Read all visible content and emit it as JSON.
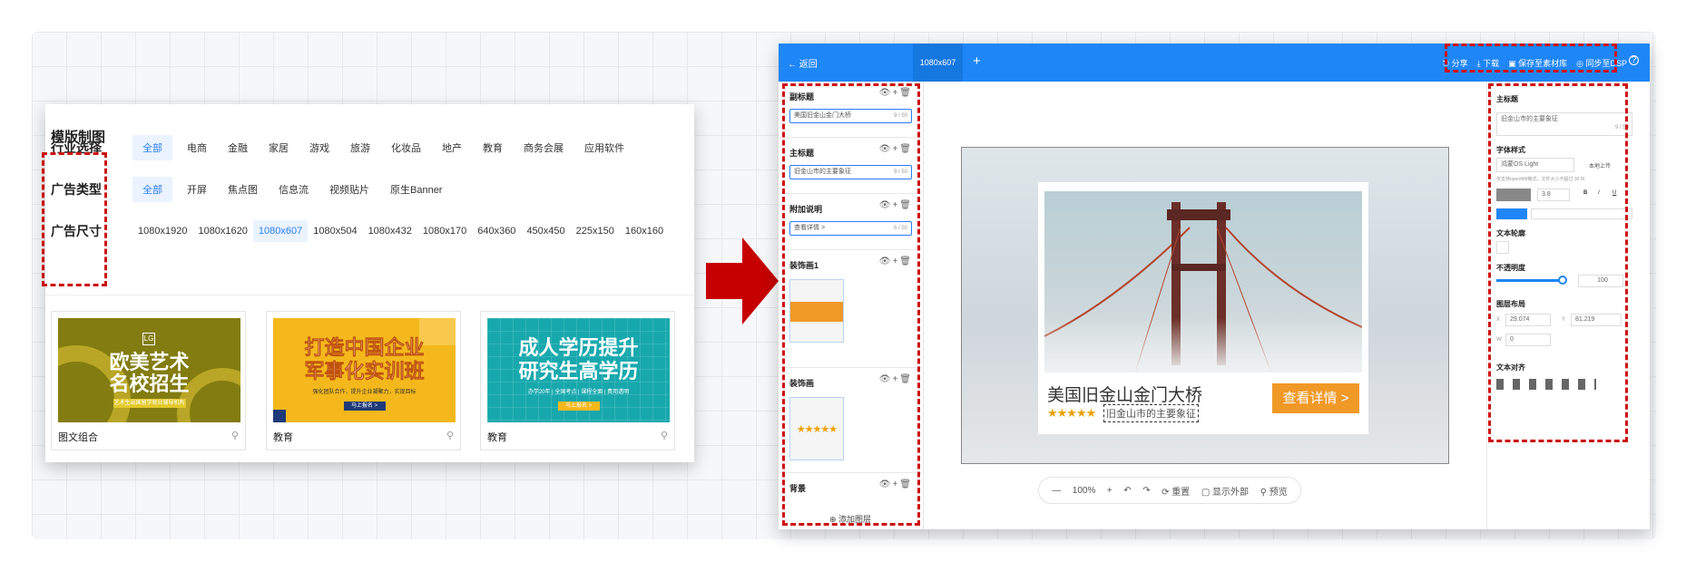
{
  "left_panel": {
    "title": "模版制图",
    "industry": {
      "label": "行业选择",
      "options": [
        "全部",
        "电商",
        "金融",
        "家居",
        "游戏",
        "旅游",
        "化妆品",
        "地产",
        "教育",
        "商务会展",
        "应用软件"
      ]
    },
    "ad_type": {
      "label": "广告类型",
      "options": [
        "全部",
        "开屏",
        "焦点图",
        "信息流",
        "视频贴片",
        "原生Banner"
      ]
    },
    "ad_size": {
      "label": "广告尺寸",
      "options": [
        "1080x1920",
        "1080x1620",
        "1080x607",
        "1080x504",
        "1080x432",
        "1080x170",
        "640x360",
        "450x450",
        "225x150",
        "160x160"
      ]
    },
    "templates": [
      {
        "heading1": "欧美艺术",
        "heading2": "名校招生",
        "sub": "艺术生出国留学就业辅导机构",
        "button": "",
        "logo": "LG",
        "name": "图文组合"
      },
      {
        "heading1": "打造中国企业",
        "heading2": "军事化实训班",
        "sub": "强化团队合作，提升企业凝聚力，实现目标",
        "button": "马上报名 >",
        "name": "教育"
      },
      {
        "heading1": "成人学历提升",
        "heading2": "研究生高学历",
        "sub": "办学20年 | 全国考点 | 课程全面 | 费用透明",
        "button": "马上报名 >",
        "name": "教育"
      }
    ],
    "search_icon": "⚲"
  },
  "editor": {
    "back": "← 返回",
    "tab": "1080x607",
    "add_tab": "+",
    "actions": [
      "⎋ 分享",
      "⤓ 下载",
      "▣ 保存至素材库",
      "◎ 同步至DSP"
    ],
    "help": "?",
    "layers": [
      {
        "title": "副标题",
        "value": "美国旧金山金门大桥",
        "count": "9 / 50"
      },
      {
        "title": "主标题",
        "value": "旧金山市的主要象征",
        "count": "9 / 50"
      },
      {
        "title": "附加说明",
        "value": "查看详情 >",
        "count": "6 / 50"
      },
      {
        "title": "装饰画1"
      },
      {
        "title": "装饰画"
      },
      {
        "title": "背景"
      }
    ],
    "layer_icons": "👁+🗑",
    "add_layer": "⊕ 添加图层",
    "ad": {
      "title": "美国旧金山金门大桥",
      "stars": "★★★★★",
      "subtitle": "旧金山市的主要象征",
      "button": "查看详情 >"
    },
    "zoom_bar": [
      "—",
      "100%",
      "+",
      "↶",
      "↷",
      "⟳ 重置",
      "▢ 显示外部",
      "⚲ 预览"
    ],
    "props": {
      "main_title_label": "主标题",
      "main_title_value": "旧金山市的主要象征",
      "main_title_count": "9 / 50",
      "font_style_label": "字体样式",
      "font_name": "鸿蒙OS Light",
      "local_upload": "本地上传",
      "font_hint": "仅支持opentf/ttf格式，文件大小不超过 30 M",
      "font_size": "3.8",
      "bold": "B",
      "italic": "I",
      "underline": "U",
      "outline_label": "文本轮廓",
      "opacity_label": "不透明度",
      "opacity_value": "100",
      "layout_label": "图层布局",
      "x_label": "X",
      "x_value": "29.074",
      "y_label": "Y",
      "y_value": "81.219",
      "w_label": "W",
      "h_value": "0",
      "align_label": "文本对齐"
    }
  },
  "colors": {
    "brand_blue": "#1e86f6",
    "dash_red": "#cc1111",
    "arrow_red": "#c60000",
    "orange": "#f09927"
  }
}
